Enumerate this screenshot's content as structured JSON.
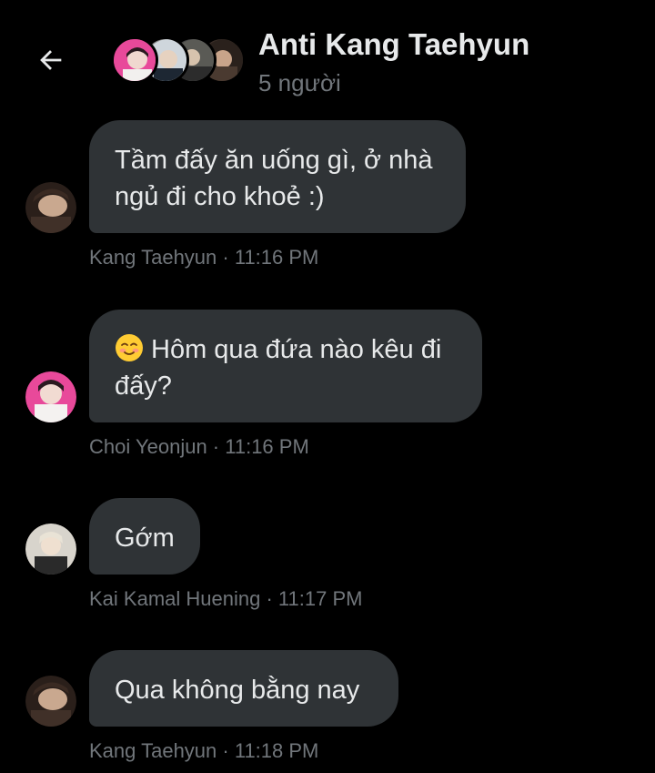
{
  "header": {
    "title": "Anti Kang Taehyun",
    "member_count": "5 người"
  },
  "messages": [
    {
      "text": "Tầm đấy ăn uống gì, ở nhà ngủ đi cho khoẻ :)",
      "sender": "Kang Taehyun",
      "time": "11:16 PM",
      "avatar": "taehyun-avatar"
    },
    {
      "emoji": "smiling-face-with-blush",
      "text": "Hôm qua đứa nào kêu đi đấy?",
      "sender": "Choi Yeonjun",
      "time": "11:16 PM",
      "avatar": "yeonjun-avatar"
    },
    {
      "text": "Gớm",
      "sender": "Kai Kamal Huening",
      "time": "11:17 PM",
      "avatar": "huening-avatar"
    },
    {
      "text": "Qua không bằng nay",
      "sender": "Kang Taehyun",
      "time": "11:18 PM",
      "avatar": "taehyun-avatar"
    }
  ],
  "colors": {
    "background": "#000000",
    "bubble": "#2f3336",
    "text": "#e7e9ea",
    "muted": "#71767b"
  }
}
